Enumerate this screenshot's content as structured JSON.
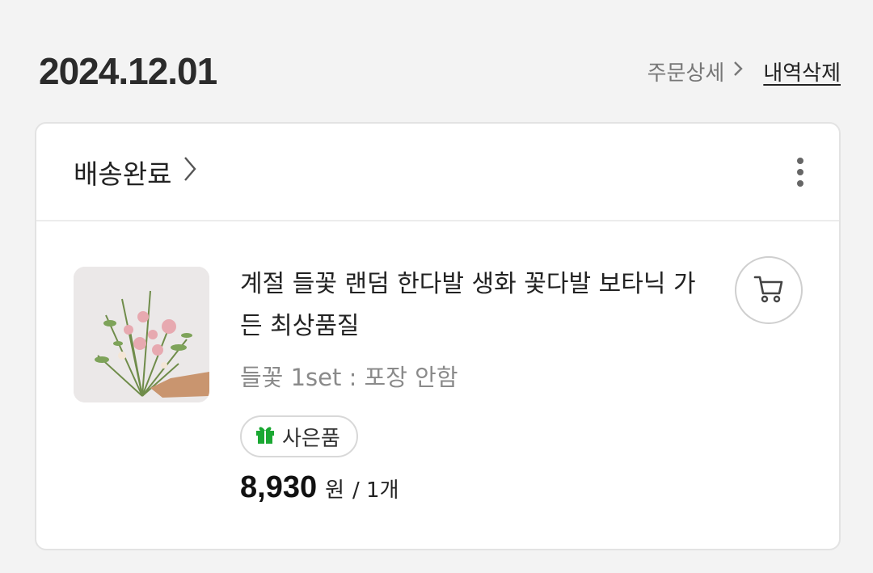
{
  "order": {
    "date": "2024.12.01",
    "detail_label": "주문상세",
    "detail_chevron": ">",
    "delete_label": "내역삭제"
  },
  "card": {
    "status": "배송완료",
    "status_icon": "chevron-right-icon",
    "menu_icon": "more-vertical-icon"
  },
  "product": {
    "name": "계절 들꽃 랜덤 한다발 생화 꽃다발 보타닉 가든 최상품질",
    "option": "들꽃 1set : 포장 안함",
    "badge_label": "사은품",
    "badge_icon": "gift-icon",
    "badge_color": "#1aa832",
    "price": "8,930",
    "price_unit": "원",
    "quantity": "/ 1개",
    "cart_icon": "cart-icon"
  }
}
